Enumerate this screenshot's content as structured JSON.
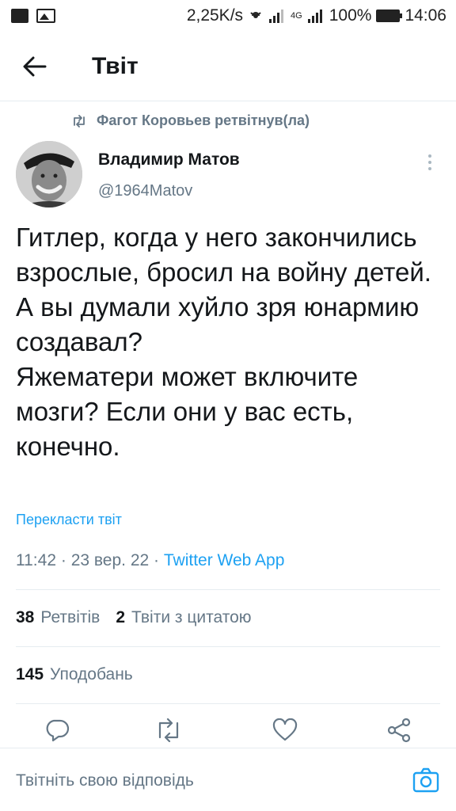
{
  "status_bar": {
    "speed": "2,25K/s",
    "network": "4G",
    "battery": "100%",
    "time": "14:06"
  },
  "header": {
    "title": "Твіт"
  },
  "retweet_line": {
    "text": "Фагот Коровьев ретвітнув(ла)"
  },
  "author": {
    "name": "Владимир Матов",
    "handle": "@1964Matov"
  },
  "tweet": {
    "text": "Гитлер, когда у него закончились взрослые, бросил на войну детей.\nА вы думали хуйло зря юнармию создавал?\nЯжематери может включите мозги? Если они у вас есть, конечно.",
    "translate_label": "Перекласти твіт",
    "time": "11:42",
    "date": "23 вер. 22",
    "separator": "·",
    "app": "Twitter Web App"
  },
  "stats": {
    "retweets_count": "38",
    "retweets_label": "Ретвітів",
    "quotes_count": "2",
    "quotes_label": "Твіти з цитатою",
    "likes_count": "145",
    "likes_label": "Уподобань"
  },
  "actions": [
    {
      "icon": "reply-icon"
    },
    {
      "icon": "retweet-icon"
    },
    {
      "icon": "like-icon"
    },
    {
      "icon": "share-icon"
    }
  ],
  "reply": {
    "placeholder": "Твітніть свою відповідь"
  },
  "colors": {
    "accent": "#1da1f2",
    "secondary_text": "#657786",
    "primary_text": "#14171a",
    "divider": "#e6ecf0"
  }
}
